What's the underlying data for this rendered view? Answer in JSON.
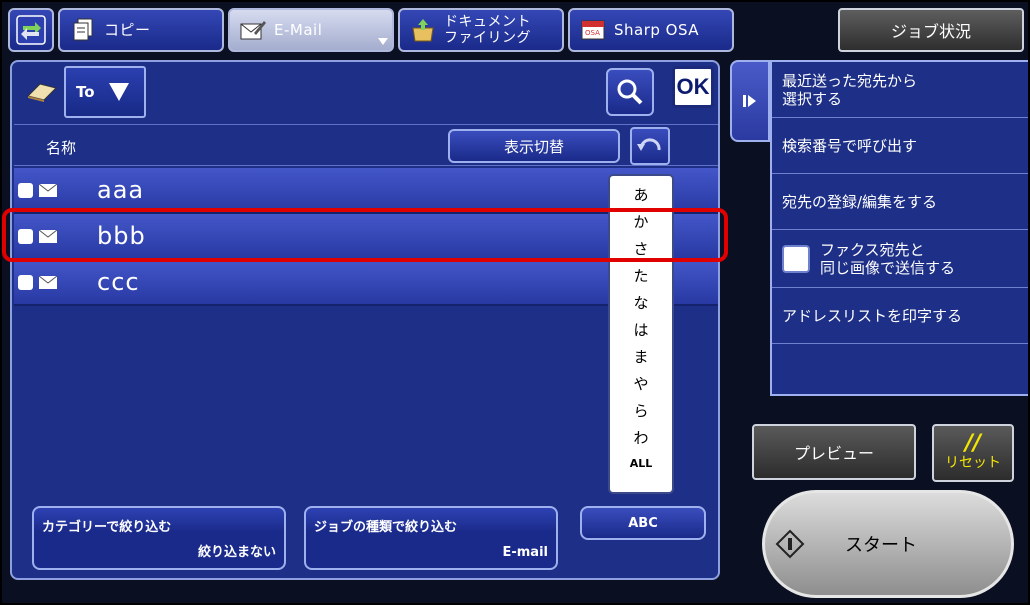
{
  "top_tabs": {
    "copy_label": "コピー",
    "email_label": "E-Mail",
    "docfiling_line1": "ドキュメント",
    "docfiling_line2": "ファイリング",
    "sharposa_label": "Sharp OSA",
    "job_status_label": "ジョブ状況"
  },
  "address_panel": {
    "to_label": "To",
    "ok_label": "OK",
    "column_name": "名称",
    "switch_display_label": "表示切替",
    "entries": [
      {
        "name": "aaa"
      },
      {
        "name": "bbb"
      },
      {
        "name": "ccc"
      }
    ],
    "kana_index": [
      "あ",
      "か",
      "さ",
      "た",
      "な",
      "は",
      "ま",
      "や",
      "ら",
      "わ"
    ],
    "kana_all": "ALL",
    "filter_category_title": "カテゴリーで絞り込む",
    "filter_category_value": "絞り込まない",
    "filter_job_title": "ジョブの種類で絞り込む",
    "filter_job_value": "E-mail",
    "abc_label": "ABC"
  },
  "side_menu": {
    "recent_line1": "最近送った宛先から",
    "recent_line2": "選択する",
    "search_number": "検索番号で呼び出す",
    "register_edit": "宛先の登録/編集をする",
    "fax_same_line1": "ファクス宛先と",
    "fax_same_line2": "同じ画像で送信する",
    "print_list": "アドレスリストを印字する"
  },
  "actions": {
    "preview_label": "プレビュー",
    "reset_symbol": "//",
    "reset_label": "リセット",
    "start_label": "スタート"
  },
  "colors": {
    "highlight": "#e00000",
    "panel_blue": "#1d2f86",
    "reset_yellow": "#f5e600"
  }
}
